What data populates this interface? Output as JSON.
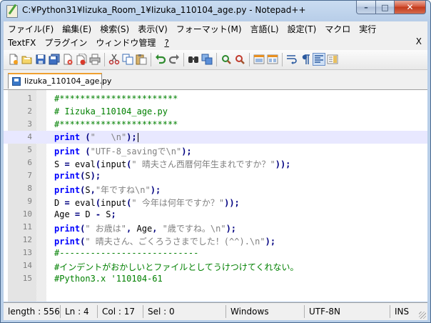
{
  "window": {
    "title": "C:¥Python31¥Iizuka_Room_1¥Iizuka_110104_age.py - Notepad++",
    "minimize_glyph": "–",
    "maximize_glyph": "□",
    "close_glyph": "✕"
  },
  "menu": {
    "row1": [
      "ファイル(F)",
      "編集(E)",
      "検索(S)",
      "表示(V)",
      "フォーマット(M)",
      "言語(L)",
      "設定(T)",
      "マクロ",
      "実行"
    ],
    "row2": [
      "TextFX",
      "プラグイン",
      "ウィンドウ管理",
      "?"
    ],
    "close_glyph": "X"
  },
  "toolbar": {
    "icons": [
      "new-icon",
      "open-icon",
      "save-icon",
      "save-all-icon",
      "close-icon",
      "close-all-icon",
      "print-icon",
      "cut-icon",
      "copy-icon",
      "paste-icon",
      "undo-icon",
      "redo-icon",
      "find-icon",
      "replace-icon",
      "zoom-in-icon",
      "zoom-out-icon",
      "sync-vertical-icon",
      "sync-horizontal-icon",
      "word-wrap-icon",
      "show-all-chars-icon",
      "indent-guide-icon",
      "doc-map-icon"
    ]
  },
  "tab": {
    "label": "Iizuka_110104_age.py"
  },
  "editor": {
    "current_line": 4,
    "lines": [
      {
        "n": "1",
        "parts": [
          [
            "cm",
            "#***********************"
          ]
        ]
      },
      {
        "n": "2",
        "parts": [
          [
            "cm",
            "# Iizuka_110104_age.py"
          ]
        ]
      },
      {
        "n": "3",
        "parts": [
          [
            "cm",
            "#***********************"
          ]
        ]
      },
      {
        "n": "4",
        "parts": [
          [
            "kw",
            "print"
          ],
          [
            "df",
            " "
          ],
          [
            "op",
            "("
          ],
          [
            "st",
            "\"   \\n\""
          ],
          [
            "op",
            ");"
          ]
        ]
      },
      {
        "n": "5",
        "parts": [
          [
            "kw",
            "print"
          ],
          [
            "df",
            " "
          ],
          [
            "op",
            "("
          ],
          [
            "st",
            "\"UTF-8_savingで\\n\""
          ],
          [
            "op",
            ");"
          ]
        ]
      },
      {
        "n": "6",
        "parts": [
          [
            "df",
            "S "
          ],
          [
            "op",
            "="
          ],
          [
            "df",
            " eval"
          ],
          [
            "op",
            "("
          ],
          [
            "df",
            "input"
          ],
          [
            "op",
            "("
          ],
          [
            "st",
            "\" 晴夫さん西暦何年生まれですか？\""
          ],
          [
            "op",
            "));"
          ]
        ]
      },
      {
        "n": "7",
        "parts": [
          [
            "kw",
            "print"
          ],
          [
            "op",
            "("
          ],
          [
            "df",
            "S"
          ],
          [
            "op",
            ");"
          ]
        ]
      },
      {
        "n": "8",
        "parts": [
          [
            "kw",
            "print"
          ],
          [
            "op",
            "("
          ],
          [
            "df",
            "S"
          ],
          [
            "op",
            ","
          ],
          [
            "st",
            "\"年ですね\\n\""
          ],
          [
            "op",
            ");"
          ]
        ]
      },
      {
        "n": "9",
        "parts": [
          [
            "df",
            "D "
          ],
          [
            "op",
            "="
          ],
          [
            "df",
            " eval"
          ],
          [
            "op",
            "("
          ],
          [
            "df",
            "input"
          ],
          [
            "op",
            "("
          ],
          [
            "st",
            "\" 今年は何年ですか？\""
          ],
          [
            "op",
            "));"
          ]
        ]
      },
      {
        "n": "10",
        "parts": [
          [
            "df",
            "Age "
          ],
          [
            "op",
            "="
          ],
          [
            "df",
            " D "
          ],
          [
            "op",
            "-"
          ],
          [
            "df",
            " S"
          ],
          [
            "op",
            ";"
          ]
        ]
      },
      {
        "n": "11",
        "parts": [
          [
            "kw",
            "print"
          ],
          [
            "op",
            "("
          ],
          [
            "st",
            "\" お歳は\""
          ],
          [
            "op",
            ","
          ],
          [
            "df",
            " Age"
          ],
          [
            "op",
            ","
          ],
          [
            "df",
            " "
          ],
          [
            "st",
            "\"歳ですね。\\n\""
          ],
          [
            "op",
            ");"
          ]
        ]
      },
      {
        "n": "12",
        "parts": [
          [
            "kw",
            "print"
          ],
          [
            "op",
            "("
          ],
          [
            "st",
            "\" 晴夫さん、ごくろうさまでした！(^^).\\n\""
          ],
          [
            "op",
            ");"
          ]
        ]
      },
      {
        "n": "13",
        "parts": [
          [
            "cm",
            "#---------------------------"
          ]
        ]
      },
      {
        "n": "14",
        "parts": [
          [
            "cm",
            "#インデントがおかしいとファイルとしてうけつけてくれない。"
          ]
        ]
      },
      {
        "n": "15",
        "parts": [
          [
            "cm",
            "#Python3.x '110104-61"
          ]
        ]
      }
    ]
  },
  "status": {
    "length": "length : 556",
    "ln": "Ln : 4",
    "col": "Col : 17",
    "sel": "Sel : 0",
    "eol": "Windows",
    "encoding": "UTF-8N",
    "mode": "INS"
  }
}
